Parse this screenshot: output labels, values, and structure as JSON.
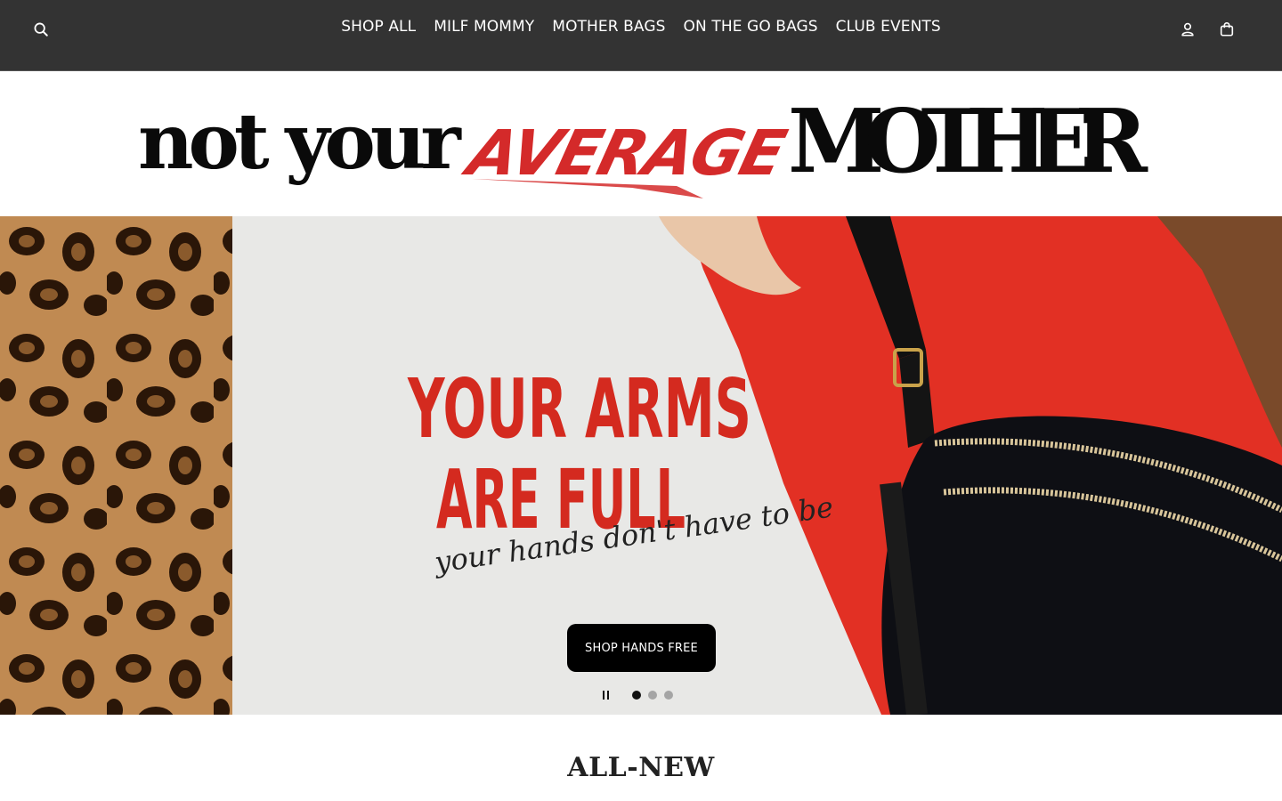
{
  "header": {
    "nav": [
      {
        "label": "SHOP ALL"
      },
      {
        "label": "MILF MOMMY"
      },
      {
        "label": "MOTHER BAGS"
      },
      {
        "label": "ON THE GO BAGS"
      },
      {
        "label": "CLUB EVENTS"
      }
    ],
    "icons": {
      "search": "search-icon",
      "account": "account-icon",
      "cart": "cart-icon"
    }
  },
  "logo": {
    "part1": "not your",
    "part2": "AVERAGE",
    "part3": "MOTHER",
    "accent_color": "#d42a2a"
  },
  "hero": {
    "headline_line1": "YOUR ARMS",
    "headline_line2": "ARE FULL",
    "script_line": "your hands don't have to be",
    "cta_label": "SHOP HANDS FREE",
    "slides_total": 3,
    "active_slide": 1,
    "headline_color": "#d42a1f"
  },
  "section": {
    "title": "ALL-NEW"
  }
}
